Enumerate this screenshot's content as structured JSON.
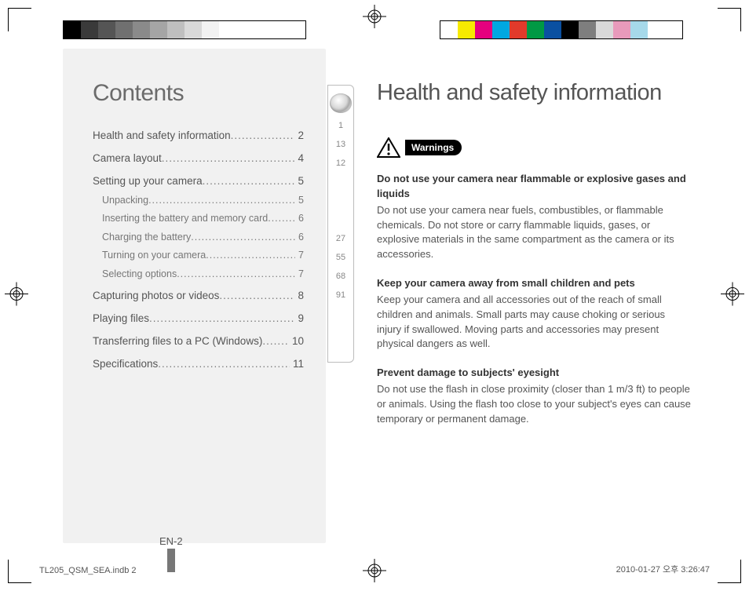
{
  "swatches_left": [
    "#000000",
    "#3a3a3a",
    "#555555",
    "#707070",
    "#8a8a8a",
    "#a5a5a5",
    "#bfbfbf",
    "#d9d9d9",
    "#f2f2f2",
    "#ffffff",
    "#ffffff",
    "#ffffff",
    "#ffffff",
    "#ffffff"
  ],
  "swatches_right": [
    "#ffffff",
    "#f7ea00",
    "#e5007e",
    "#00a8e1",
    "#e23a2b",
    "#009944",
    "#0a50a1",
    "#000000",
    "#7e7e7e",
    "#d9d9d9",
    "#e89abb",
    "#a6d9ea",
    "#ffffff",
    "#ffffff"
  ],
  "contents": {
    "title": "Contents",
    "items": [
      {
        "label": "Health and safety information",
        "page": "2",
        "sub": []
      },
      {
        "label": "Camera layout",
        "page": "4",
        "sub": []
      },
      {
        "label": "Setting up your camera",
        "page": "5",
        "sub": [
          {
            "label": "Unpacking",
            "page": "5"
          },
          {
            "label": "Inserting the battery and memory card",
            "page": "6"
          },
          {
            "label": "Charging the battery",
            "page": "6"
          },
          {
            "label": "Turning on your camera",
            "page": "7"
          },
          {
            "label": "Selecting options",
            "page": "7"
          }
        ]
      },
      {
        "label": "Capturing photos or videos",
        "page": "8",
        "sub": []
      },
      {
        "label": "Playing files",
        "page": "9",
        "sub": []
      },
      {
        "label": "Transferring files to a PC (Windows)",
        "page": "10",
        "sub": []
      },
      {
        "label": "Specifications",
        "page": "11",
        "sub": []
      }
    ]
  },
  "tabguide": [
    "1",
    "13",
    "12",
    "27",
    "55",
    "68",
    "91"
  ],
  "right": {
    "title": "Health and safety information",
    "badge": "Warnings",
    "sections": [
      {
        "head": "Do not use your camera near flammable or explosive gases and liquids",
        "body": "Do not use your camera near fuels, combustibles, or flammable chemicals. Do not store or carry flammable liquids, gases, or explosive materials in the same compartment as the camera or its accessories."
      },
      {
        "head": "Keep your camera away from small children and pets",
        "body": "Keep your camera and all accessories out of the reach of small children and animals. Small parts may cause choking or serious injury if swallowed. Moving parts and accessories may present physical dangers as well."
      },
      {
        "head": "Prevent damage to subjects' eyesight",
        "body": "Do not use the flash in close proximity (closer than 1 m/3 ft) to people or animals. Using the flash too close to your subject's eyes can cause temporary or permanent damage."
      }
    ]
  },
  "page_number": "EN-2",
  "slug_left": "TL205_QSM_SEA.indb   2",
  "slug_right": "2010-01-27   오후 3:26:47"
}
